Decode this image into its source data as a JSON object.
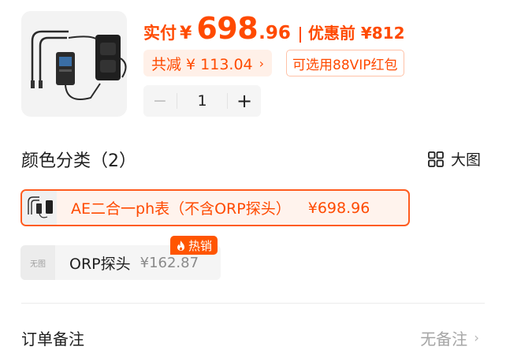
{
  "product": {
    "image_icon": "ph-meter-controller-image"
  },
  "price": {
    "label": "实付",
    "currency": "¥",
    "integer": "698",
    "decimal": ".96",
    "before_label": "优惠前 ¥812",
    "accent_color": "#ff4a00"
  },
  "discount": {
    "text": "共减 ¥ 113.04",
    "chevron": "›",
    "vip_text": "可选用88VIP红包"
  },
  "stepper": {
    "minus": "−",
    "quantity": "1",
    "plus": "+"
  },
  "variants_section": {
    "title": "颜色分类（2）",
    "big_view_label": "大图",
    "big_view_icon": "grid-icon",
    "items": [
      {
        "name": "AE二合一ph表（不含ORP探头）",
        "price": "¥698.96",
        "selected": true
      },
      {
        "name": "ORP探头",
        "price": "¥162.87",
        "selected": false,
        "thumb_text": "无图",
        "badge": "热销",
        "badge_icon": "flame-icon"
      }
    ]
  },
  "order_note": {
    "label": "订单备注",
    "value": "无备注",
    "chevron": "›"
  }
}
